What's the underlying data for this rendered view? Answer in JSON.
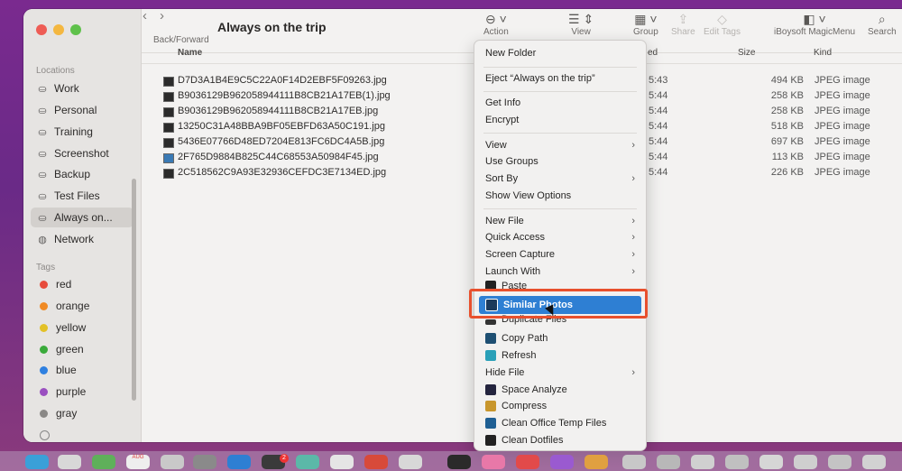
{
  "window": {
    "title": "Always on the trip",
    "nav_label": "Back/Forward",
    "toolbar": {
      "action_label": "Action",
      "view_label": "View",
      "group_label": "Group",
      "share_label": "Share",
      "edit_tags_label": "Edit Tags",
      "magicmenu_label": "iBoysoft MagicMenu",
      "search_label": "Search"
    }
  },
  "sidebar": {
    "locations_header": "Locations",
    "items": [
      {
        "label": "Work"
      },
      {
        "label": "Personal"
      },
      {
        "label": "Training"
      },
      {
        "label": "Screenshot"
      },
      {
        "label": "Backup"
      },
      {
        "label": "Test Files"
      },
      {
        "label": "Always on..."
      },
      {
        "label": "Network"
      }
    ],
    "tags_header": "Tags",
    "tags": [
      {
        "label": "red",
        "color": "#e74c3c"
      },
      {
        "label": "orange",
        "color": "#f08a24"
      },
      {
        "label": "yellow",
        "color": "#e3c127"
      },
      {
        "label": "green",
        "color": "#3aaa3a"
      },
      {
        "label": "blue",
        "color": "#2f80e0"
      },
      {
        "label": "purple",
        "color": "#9a4fc0"
      },
      {
        "label": "gray",
        "color": "#8a8886"
      }
    ]
  },
  "list": {
    "columns": {
      "name": "Name",
      "date": "ed",
      "size": "Size",
      "kind": "Kind"
    },
    "rows": [
      {
        "name": "D7D3A1B4E9C5C22A0F14D2EBF5F09263.jpg",
        "time": "5:43",
        "size": "494 KB",
        "kind": "JPEG image"
      },
      {
        "name": "B9036129B962058944111B8CB21A17EB(1).jpg",
        "time": "5:44",
        "size": "258 KB",
        "kind": "JPEG image"
      },
      {
        "name": "B9036129B962058944111B8CB21A17EB.jpg",
        "time": "5:44",
        "size": "258 KB",
        "kind": "JPEG image"
      },
      {
        "name": "13250C31A48BBA9BF05EBFD63A50C191.jpg",
        "time": "5:44",
        "size": "518 KB",
        "kind": "JPEG image"
      },
      {
        "name": "5436E07766D48ED7204E813FC6DC4A5B.jpg",
        "time": "5:44",
        "size": "697 KB",
        "kind": "JPEG image"
      },
      {
        "name": "2F765D9884B825C44C68553A50984F45.jpg",
        "time": "5:44",
        "size": "113 KB",
        "kind": "JPEG image"
      },
      {
        "name": "2C518562C9A93E32936CEFDC3E7134ED.jpg",
        "time": "5:44",
        "size": "226 KB",
        "kind": "JPEG image"
      }
    ]
  },
  "menu": {
    "new_folder": "New Folder",
    "eject": "Eject “Always on the trip”",
    "get_info": "Get Info",
    "encrypt": "Encrypt",
    "view": "View",
    "use_groups": "Use Groups",
    "sort_by": "Sort By",
    "show_view_options": "Show View Options",
    "new_file": "New File",
    "quick_access": "Quick Access",
    "screen_capture": "Screen Capture",
    "launch_with": "Launch With",
    "paste": "Paste",
    "similar_photos": "Similar Photos",
    "duplicate_files": "Duplicate Files",
    "copy_path": "Copy Path",
    "refresh": "Refresh",
    "hide_file": "Hide File",
    "space_analyze": "Space Analyze",
    "compress": "Compress",
    "clean_office": "Clean Office Temp Files",
    "clean_dotfiles": "Clean Dotfiles"
  },
  "dock": {
    "badge_count": "2",
    "calendar_label": "AUG"
  }
}
